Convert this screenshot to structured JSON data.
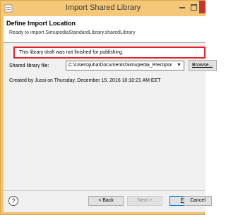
{
  "window": {
    "title": "Import Shared Library",
    "colors": {
      "frame": "#f0c471",
      "close_button": "#c7352c",
      "error_border": "#e0212b"
    }
  },
  "header": {
    "title": "Define Import Location",
    "subtitle": "Ready to import SimupediaStandardLibrary.sharedLibrary"
  },
  "error": {
    "message": "This library draft was not finished for publishing."
  },
  "form": {
    "shared_library_label": "Shared library file:",
    "shared_library_value": "C:\\Users\\juha\\Documents\\Simupedia_R\\eclipse\\sha",
    "browse_label": "Browse...",
    "created_by": "Created by Jussi on Thursday, December 15, 2016 10:10:21 AM EET"
  },
  "footer": {
    "help_icon": "question-mark-icon",
    "back_label": "< Back",
    "next_label": "Next >",
    "finish_label": "Finish",
    "cancel_label": "Cancel"
  }
}
